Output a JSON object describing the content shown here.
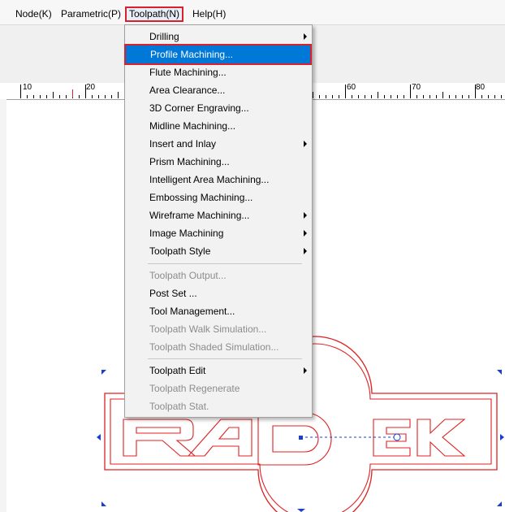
{
  "menubar": {
    "items": [
      "Node(K)",
      "Parametric(P)",
      "Toolpath(N)",
      "Help(H)"
    ]
  },
  "ruler": {
    "labels": [
      "10",
      "20",
      "60",
      "70",
      "80"
    ]
  },
  "dropdown": {
    "items": [
      {
        "label": "Drilling",
        "submenu": true,
        "disabled": false
      },
      {
        "label": "Profile Machining...",
        "submenu": false,
        "disabled": false,
        "highlighted": true
      },
      {
        "label": "Flute Machining...",
        "submenu": false,
        "disabled": false
      },
      {
        "label": "Area Clearance...",
        "submenu": false,
        "disabled": false
      },
      {
        "label": "3D Corner Engraving...",
        "submenu": false,
        "disabled": false
      },
      {
        "label": "Midline Machining...",
        "submenu": false,
        "disabled": false
      },
      {
        "label": "Insert and Inlay",
        "submenu": true,
        "disabled": false
      },
      {
        "label": "Prism Machining...",
        "submenu": false,
        "disabled": false
      },
      {
        "label": "Intelligent Area Machining...",
        "submenu": false,
        "disabled": false
      },
      {
        "label": "Embossing Machining...",
        "submenu": false,
        "disabled": false
      },
      {
        "label": "Wireframe  Machining...",
        "submenu": true,
        "disabled": false
      },
      {
        "label": "Image Machining",
        "submenu": true,
        "disabled": false
      },
      {
        "label": "Toolpath Style",
        "submenu": true,
        "disabled": false
      },
      {
        "label": "Toolpath Output...",
        "submenu": false,
        "disabled": true
      },
      {
        "label": "Post Set ...",
        "submenu": false,
        "disabled": false
      },
      {
        "label": "Tool Management...",
        "submenu": false,
        "disabled": false
      },
      {
        "label": "Toolpath Walk Simulation...",
        "submenu": false,
        "disabled": true
      },
      {
        "label": "Toolpath Shaded Simulation...",
        "submenu": false,
        "disabled": true
      },
      {
        "label": "Toolpath Edit",
        "submenu": true,
        "disabled": false
      },
      {
        "label": "Toolpath Regenerate",
        "submenu": false,
        "disabled": true
      },
      {
        "label": "Toolpath Stat.",
        "submenu": false,
        "disabled": true
      }
    ]
  },
  "colors": {
    "highlight": "#0078d7",
    "callout": "#d9202c",
    "drawing": "#e02020",
    "selection": "#1a3fd0"
  },
  "canvas": {
    "logo_text": "RADEK"
  }
}
